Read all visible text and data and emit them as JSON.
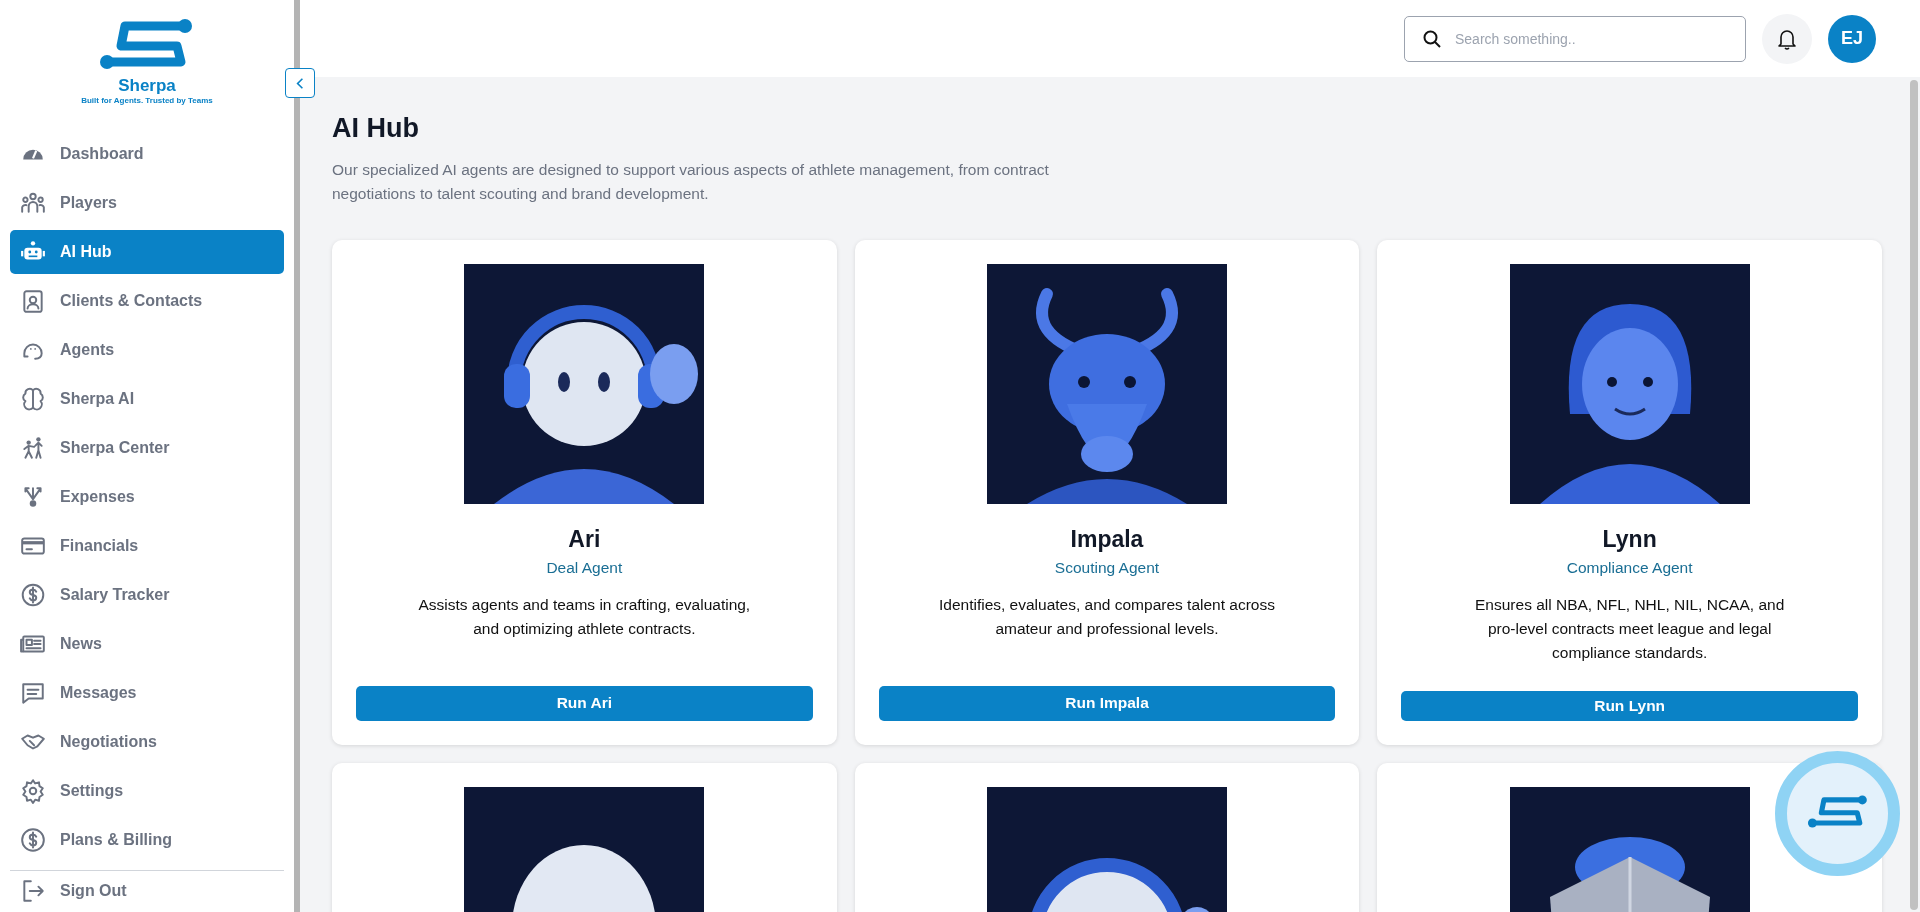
{
  "logo": {
    "name": "Sherpa",
    "tagline": "Built for Agents. Trusted by Teams"
  },
  "sidebar": {
    "items": [
      {
        "label": "Dashboard",
        "selected": false
      },
      {
        "label": "Players",
        "selected": false
      },
      {
        "label": "AI Hub",
        "selected": true
      },
      {
        "label": "Clients & Contacts",
        "selected": false
      },
      {
        "label": "Agents",
        "selected": false
      },
      {
        "label": "Sherpa AI",
        "selected": false
      },
      {
        "label": "Sherpa Center",
        "selected": false
      },
      {
        "label": "Expenses",
        "selected": false
      },
      {
        "label": "Financials",
        "selected": false
      },
      {
        "label": "Salary Tracker",
        "selected": false
      },
      {
        "label": "News",
        "selected": false
      },
      {
        "label": "Messages",
        "selected": false
      },
      {
        "label": "Negotiations",
        "selected": false
      },
      {
        "label": "Settings",
        "selected": false
      },
      {
        "label": "Plans & Billing",
        "selected": false
      }
    ],
    "sign_out": "Sign Out"
  },
  "header": {
    "search": {
      "placeholder": "Search something.."
    },
    "avatar": "EJ"
  },
  "page": {
    "title": "AI Hub",
    "description": "Our specialized AI agents are designed to support various aspects of athlete management, from contract negotiations to talent scouting and brand development."
  },
  "agents": [
    {
      "image": {
        "kind": "picture"
      },
      "name": "Ari",
      "role": "Deal Agent",
      "description": "Assists agents and teams in crafting, evaluating, and optimizing athlete contracts.",
      "button": "Run Ari"
    },
    {
      "image": {
        "kind": "picture"
      },
      "name": "Impala",
      "role": "Scouting Agent",
      "description": "Identifies, evaluates, and compares talent across amateur and professional levels.",
      "button": "Run Impala"
    },
    {
      "image": {
        "kind": "picture"
      },
      "name": "Lynn",
      "role": "Compliance Agent",
      "description": "Ensures all NBA, NFL, NHL, NIL, NCAA, and pro-level contracts meet league and legal compliance standards.",
      "button": "Run Lynn"
    },
    {
      "image": {
        "kind": "picture"
      }
    },
    {
      "image": {
        "kind": "picture"
      }
    },
    {
      "image": {
        "kind": "picture"
      }
    }
  ]
}
